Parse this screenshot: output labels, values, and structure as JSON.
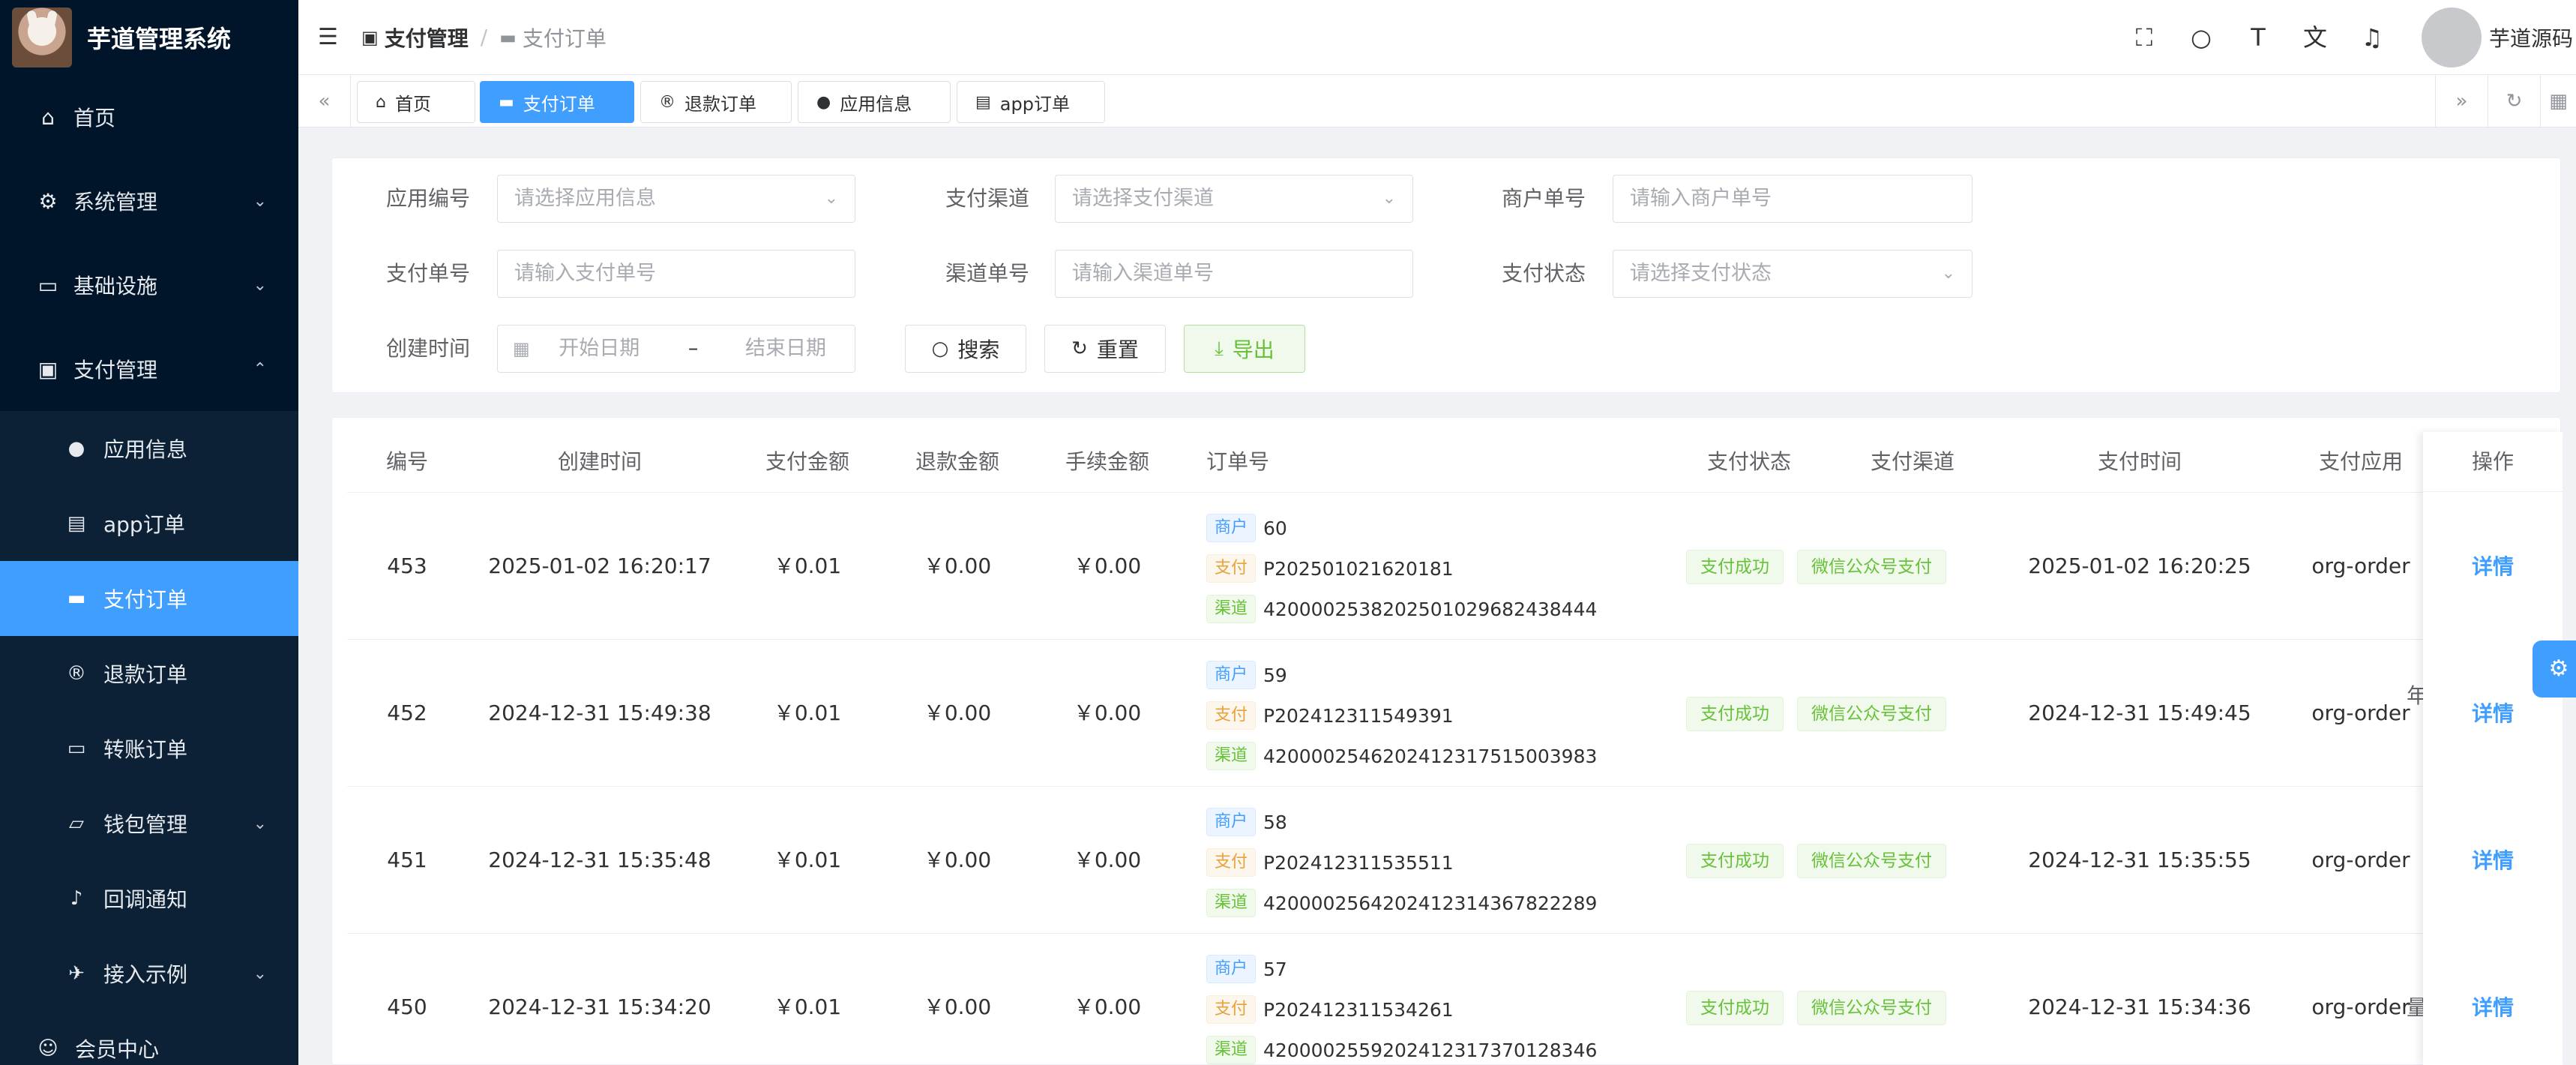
{
  "app": {
    "title": "芋道管理系统",
    "user_name": "芋道源码"
  },
  "sidebar": {
    "items": [
      {
        "label": "首页",
        "icon": "home-icon",
        "glyph": "⌂"
      },
      {
        "label": "系统管理",
        "icon": "gear-icon",
        "glyph": "⚙"
      },
      {
        "label": "基础设施",
        "icon": "monitor-icon",
        "glyph": "▭"
      },
      {
        "label": "支付管理",
        "icon": "pay-icon",
        "glyph": "▣"
      }
    ],
    "sub_items": [
      {
        "label": "应用信息",
        "icon": "apple-icon",
        "glyph": "●"
      },
      {
        "label": "app订单",
        "icon": "box-icon",
        "glyph": "▤"
      },
      {
        "label": "支付订单",
        "icon": "card-icon",
        "glyph": "▬"
      },
      {
        "label": "退款订单",
        "icon": "registered-icon",
        "glyph": "®"
      },
      {
        "label": "转账订单",
        "icon": "transfer-icon",
        "glyph": "▭"
      },
      {
        "label": "钱包管理",
        "icon": "wallet-icon",
        "glyph": "▱"
      },
      {
        "label": "回调通知",
        "icon": "bell-icon",
        "glyph": "♪"
      },
      {
        "label": "接入示例",
        "icon": "demo-icon",
        "glyph": "✈"
      },
      {
        "label": "会员中心",
        "icon": "member-icon",
        "glyph": "☺"
      }
    ]
  },
  "header": {
    "breadcrumb": [
      "支付管理",
      "支付订单"
    ]
  },
  "tabs": [
    {
      "label": "首页",
      "glyph": "⌂",
      "icon": "home-icon"
    },
    {
      "label": "支付订单",
      "glyph": "▬",
      "icon": "card-icon"
    },
    {
      "label": "退款订单",
      "glyph": "®",
      "icon": "registered-icon"
    },
    {
      "label": "应用信息",
      "glyph": "●",
      "icon": "apple-icon"
    },
    {
      "label": "app订单",
      "glyph": "▤",
      "icon": "box-icon"
    }
  ],
  "search": {
    "app_label": "应用编号",
    "app_placeholder": "请选择应用信息",
    "channel_label": "支付渠道",
    "channel_placeholder": "请选择支付渠道",
    "merchant_label": "商户单号",
    "merchant_placeholder": "请输入商户单号",
    "pay_no_label": "支付单号",
    "pay_no_placeholder": "请输入支付单号",
    "channel_no_label": "渠道单号",
    "channel_no_placeholder": "请输入渠道单号",
    "status_label": "支付状态",
    "status_placeholder": "请选择支付状态",
    "time_label": "创建时间",
    "start_placeholder": "开始日期",
    "range_sep": "–",
    "end_placeholder": "结束日期",
    "search_btn": "搜索",
    "reset_btn": "重置",
    "export_btn": "导出"
  },
  "table": {
    "headers": [
      "编号",
      "创建时间",
      "支付金额",
      "退款金额",
      "手续金额",
      "订单号",
      "支付状态",
      "支付渠道",
      "支付时间",
      "支付应用",
      "操作"
    ],
    "tag_merchant": "商户",
    "tag_pay": "支付",
    "tag_channel": "渠道",
    "rows": [
      {
        "id": "453",
        "created": "2025-01-02 16:20:17",
        "amount": "￥0.01",
        "refund": "￥0.00",
        "fee": "￥0.00",
        "merchant_no": "60",
        "pay_no": "P202501021620181",
        "channel_no": "4200002538202501029682438444",
        "status": "支付成功",
        "channel": "微信公众号支付",
        "pay_time": "2025-01-02 16:20:25",
        "app": "org-order",
        "action": "详情"
      },
      {
        "id": "452",
        "created": "2024-12-31 15:49:38",
        "amount": "￥0.01",
        "refund": "￥0.00",
        "fee": "￥0.00",
        "merchant_no": "59",
        "pay_no": "P202412311549391",
        "channel_no": "4200002546202412317515003983",
        "status": "支付成功",
        "channel": "微信公众号支付",
        "pay_time": "2024-12-31 15:49:45",
        "app": "org-order",
        "action": "详情"
      },
      {
        "id": "451",
        "created": "2024-12-31 15:35:48",
        "amount": "￥0.01",
        "refund": "￥0.00",
        "fee": "￥0.00",
        "merchant_no": "58",
        "pay_no": "P202412311535511",
        "channel_no": "4200002564202412314367822289",
        "status": "支付成功",
        "channel": "微信公众号支付",
        "pay_time": "2024-12-31 15:35:55",
        "app": "org-order",
        "action": "详情"
      },
      {
        "id": "450",
        "created": "2024-12-31 15:34:20",
        "amount": "￥0.01",
        "refund": "￥0.00",
        "fee": "￥0.00",
        "merchant_no": "57",
        "pay_no": "P202412311534261",
        "channel_no": "4200002559202412317370128346",
        "status": "支付成功",
        "channel": "微信公众号支付",
        "pay_time": "2024-12-31 15:34:36",
        "app": "org-order",
        "action": "详情"
      }
    ],
    "peek_chars": [
      "年",
      "量"
    ]
  }
}
